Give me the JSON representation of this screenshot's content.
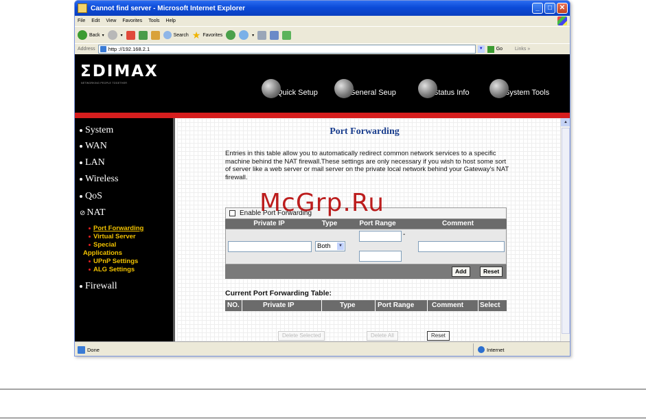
{
  "window": {
    "title": "Cannot find server - Microsoft Internet Explorer",
    "minimize": "_",
    "maximize": "□",
    "close": "✕"
  },
  "menu": [
    "File",
    "Edit",
    "View",
    "Favorites",
    "Tools",
    "Help"
  ],
  "toolbar": {
    "back": "Back",
    "search": "Search",
    "favorites": "Favorites"
  },
  "address": {
    "label": "Address",
    "url": "http ://192.168.2.1",
    "go": "Go",
    "links": "Links »"
  },
  "header": {
    "logo": "ΣDIMAX",
    "tagline": "NETWORKING PEOPLE TOGETHER",
    "nav": [
      "Quick Setup",
      "General Seup",
      "Status Info",
      "System Tools"
    ]
  },
  "sidebar": {
    "items": [
      "System",
      "WAN",
      "LAN",
      "Wireless",
      "QoS",
      "NAT",
      "Firewall"
    ],
    "nat_prefix": "⊘",
    "nat_sub": [
      "Port Forwarding",
      "Virtual Server",
      "Special",
      "Applications",
      "UPnP Settings",
      "ALG Settings"
    ]
  },
  "page": {
    "title": "Port Forwarding",
    "description": "Entries in this table allow you to automatically redirect common network services to a specific machine behind the NAT firewall.These settings are only necessary if you wish to host some sort of server like a web server or mail server on the private local network behind your Gateway's NAT firewall.",
    "enable_label": "Enable Port Forwarding",
    "columns": [
      "Private IP",
      "Type",
      "Port Range",
      "Comment"
    ],
    "type_value": "Both",
    "range_separator": "-",
    "add_button": "Add",
    "reset_button": "Reset",
    "current_title": "Current Port Forwarding Table:",
    "current_columns": [
      "NO.",
      "Private IP",
      "Type",
      "Port Range",
      "Comment",
      "Select"
    ],
    "delete_selected": "Delete Selected",
    "delete_all": "Delete All",
    "reset_bottom": "Reset"
  },
  "status": {
    "text": "Done",
    "zone": "Internet"
  },
  "watermark": "McGrp.Ru",
  "colors": {
    "title_blue": "#183c8c",
    "nav_yellow": "#f2c200",
    "band_red": "#d71e1e",
    "watermark_red": "#b40000"
  }
}
